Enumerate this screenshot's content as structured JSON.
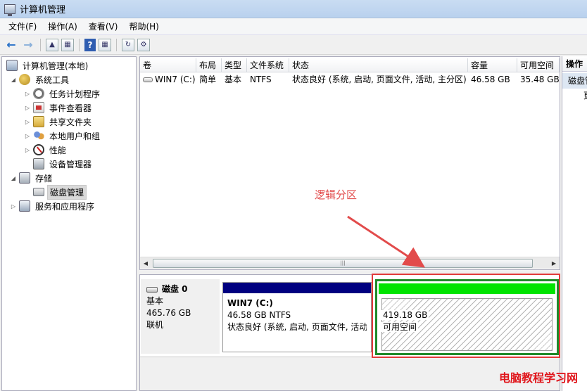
{
  "window": {
    "title": "计算机管理"
  },
  "menu": [
    "文件(F)",
    "操作(A)",
    "查看(V)",
    "帮助(H)"
  ],
  "tree": {
    "root": "计算机管理(本地)",
    "system_tools": "系统工具",
    "task_scheduler": "任务计划程序",
    "event_viewer": "事件查看器",
    "shared_folders": "共享文件夹",
    "local_users": "本地用户和组",
    "performance": "性能",
    "device_manager": "设备管理器",
    "storage": "存储",
    "disk_management": "磁盘管理",
    "services_apps": "服务和应用程序"
  },
  "volume_list": {
    "columns": [
      "卷",
      "布局",
      "类型",
      "文件系统",
      "状态",
      "容量",
      "可用空间"
    ],
    "rows": [
      [
        "WIN7 (C:)",
        "简单",
        "基本",
        "NTFS",
        "状态良好 (系统, 启动, 页面文件, 活动, 主分区)",
        "46.58 GB",
        "35.48 GB"
      ]
    ]
  },
  "annotation": {
    "label": "逻辑分区",
    "color": "#e24b4b"
  },
  "disk": {
    "name": "磁盘 0",
    "type": "基本",
    "size": "465.76 GB",
    "status": "联机",
    "partition_c": {
      "title": "WIN7  (C:)",
      "size_fs": "46.58 GB NTFS",
      "status": "状态良好 (系统, 启动, 页面文件, 活动, 主分区)"
    },
    "free": {
      "size": "419.18 GB",
      "label": "可用空间"
    }
  },
  "actions": {
    "header": "操作",
    "item": "磁盘管理",
    "sub": "更多操作"
  },
  "watermark": "电脑教程学习网",
  "colors": {
    "primary_partition_bar": "#000080",
    "free_space_bar": "#00e400",
    "highlight_box": "#e23a3a"
  }
}
